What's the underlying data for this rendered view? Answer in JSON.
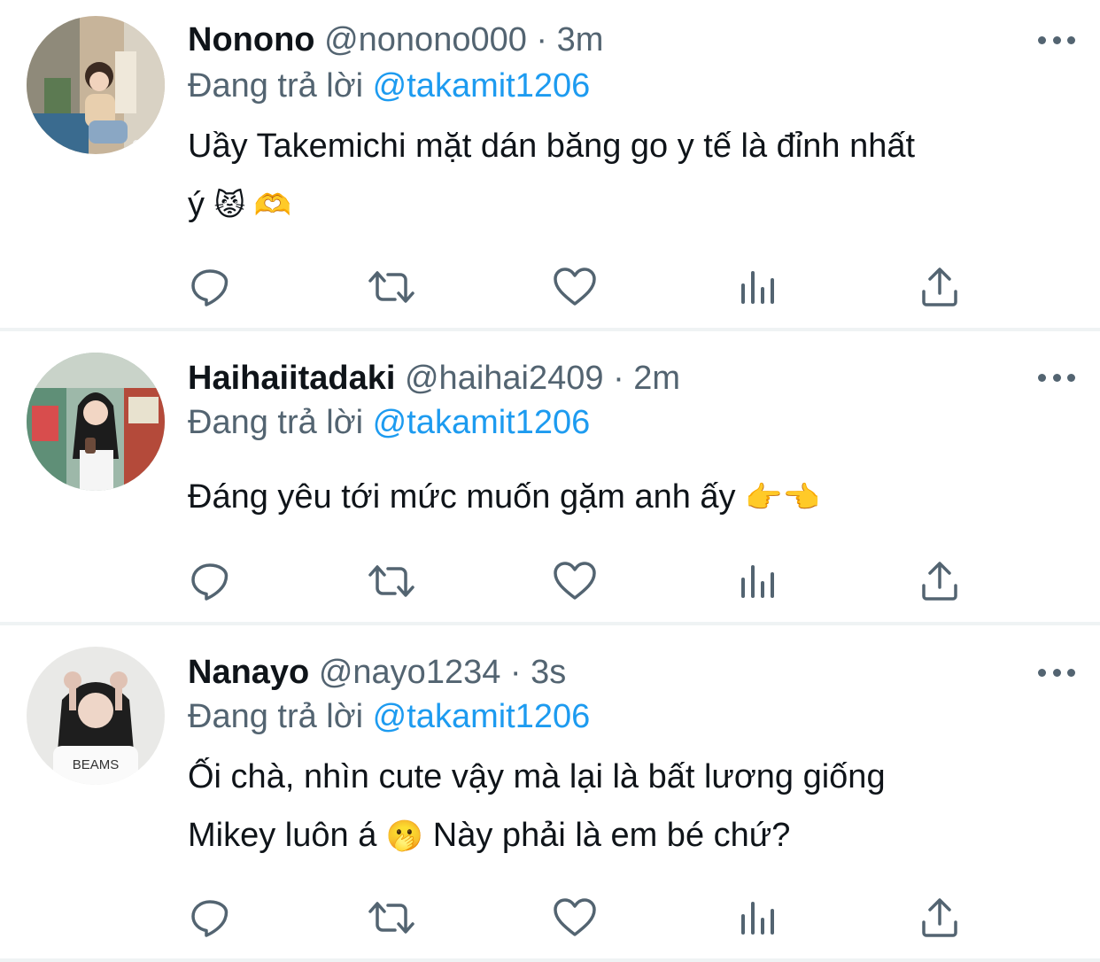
{
  "colors": {
    "text": "#0f1419",
    "secondary": "#536471",
    "link": "#1d9bf0",
    "divider": "#eff3f4"
  },
  "tweets": [
    {
      "name": "Nonono",
      "handle": "@nonono000",
      "dot": "·",
      "time": "3m",
      "reply_prefix": "Đang trả lời",
      "mention": "@takamit1206",
      "text_line1": "Uầy Takemichi mặt dán băng go y tế là đỉnh nhất",
      "text_line2": "ý",
      "emojis": "😾 🫶",
      "icons": [
        "reply-icon",
        "retweet-icon",
        "like-icon",
        "views-icon",
        "share-icon",
        "more-icon"
      ]
    },
    {
      "name": "Haihaiitadaki",
      "handle": "@haihai2409",
      "dot": "·",
      "time": "2m",
      "reply_prefix": "Đang trả lời",
      "mention": "@takamit1206",
      "text_line1": "Đáng yêu tới mức muốn gặm anh ấy",
      "emojis": "👉👈",
      "icons": [
        "reply-icon",
        "retweet-icon",
        "like-icon",
        "views-icon",
        "share-icon",
        "more-icon"
      ]
    },
    {
      "name": "Nanayo",
      "handle": "@nayo1234",
      "dot": "·",
      "time": "3s",
      "reply_prefix": "Đang trả lời",
      "mention": "@takamit1206",
      "text_line1": "Ối chà, nhìn cute vậy mà lại là bất lương giống",
      "text_line2_a": "Mikey luôn á",
      "emoji_mid": "🫢",
      "text_line2_b": "Này phải là em bé chứ?",
      "avatar_shirt_text": "BEAMS",
      "icons": [
        "reply-icon",
        "retweet-icon",
        "like-icon",
        "views-icon",
        "share-icon",
        "more-icon"
      ]
    }
  ]
}
